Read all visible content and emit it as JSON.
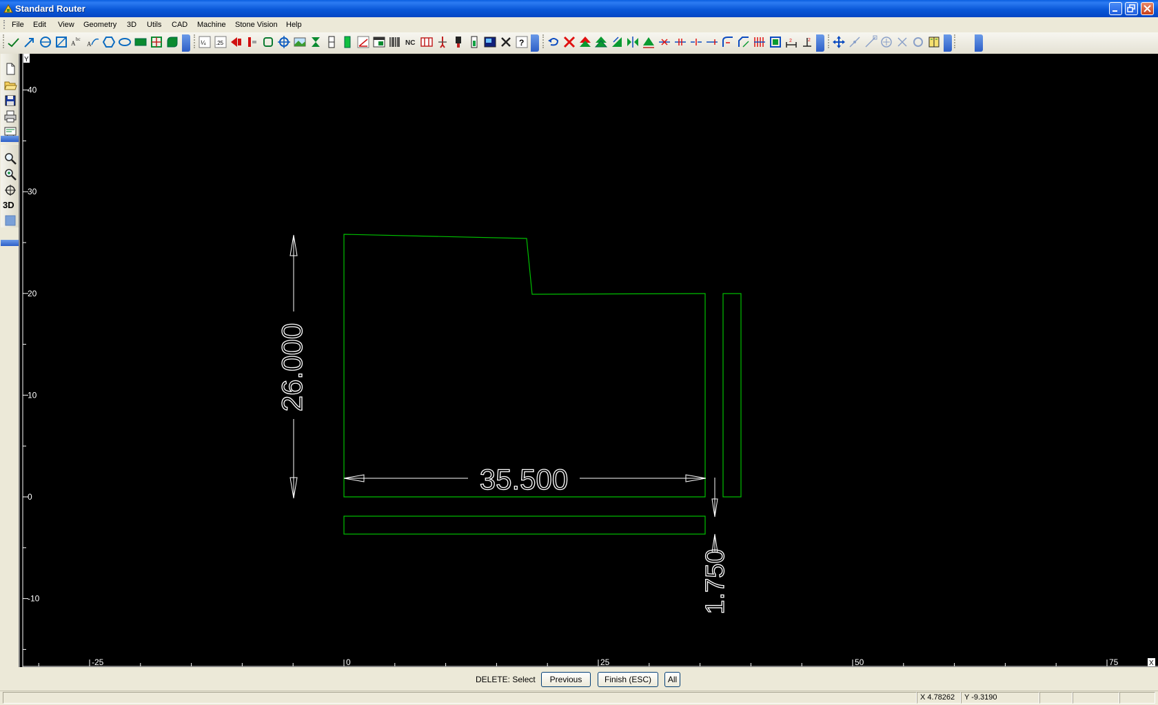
{
  "window": {
    "title": "Standard Router"
  },
  "menu": [
    "File",
    "Edit",
    "View",
    "Geometry",
    "3D",
    "Utils",
    "CAD",
    "Machine",
    "Stone Vision",
    "Help"
  ],
  "left_toolbar": {
    "mode_label": "3D"
  },
  "canvas": {
    "background": "#000000",
    "geometry_color": "#00c000",
    "dimension_color": "#ffffff",
    "axis_labels": {
      "y_corner": "Y",
      "x_corner": "X"
    },
    "y_ticks": [
      {
        "value": 40,
        "label": "40"
      },
      {
        "value": 30,
        "label": "30"
      },
      {
        "value": 20,
        "label": "20"
      },
      {
        "value": 10,
        "label": "10"
      },
      {
        "value": 0,
        "label": "0"
      },
      {
        "value": -10,
        "label": "-10"
      }
    ],
    "x_ticks": [
      {
        "value": -25,
        "label": "-25"
      },
      {
        "value": 0,
        "label": "0"
      },
      {
        "value": 25,
        "label": "25"
      },
      {
        "value": 50,
        "label": "50"
      },
      {
        "value": 75,
        "label": "75"
      }
    ],
    "dimensions": {
      "height": "26.000",
      "width": "35.500",
      "gap": "1.750"
    }
  },
  "command_bar": {
    "prompt": "DELETE: Select",
    "buttons": {
      "previous": "Previous",
      "finish": "Finish (ESC)",
      "all": "All"
    }
  },
  "status": {
    "x": "X 4.78262",
    "y": "Y -9.3190"
  }
}
